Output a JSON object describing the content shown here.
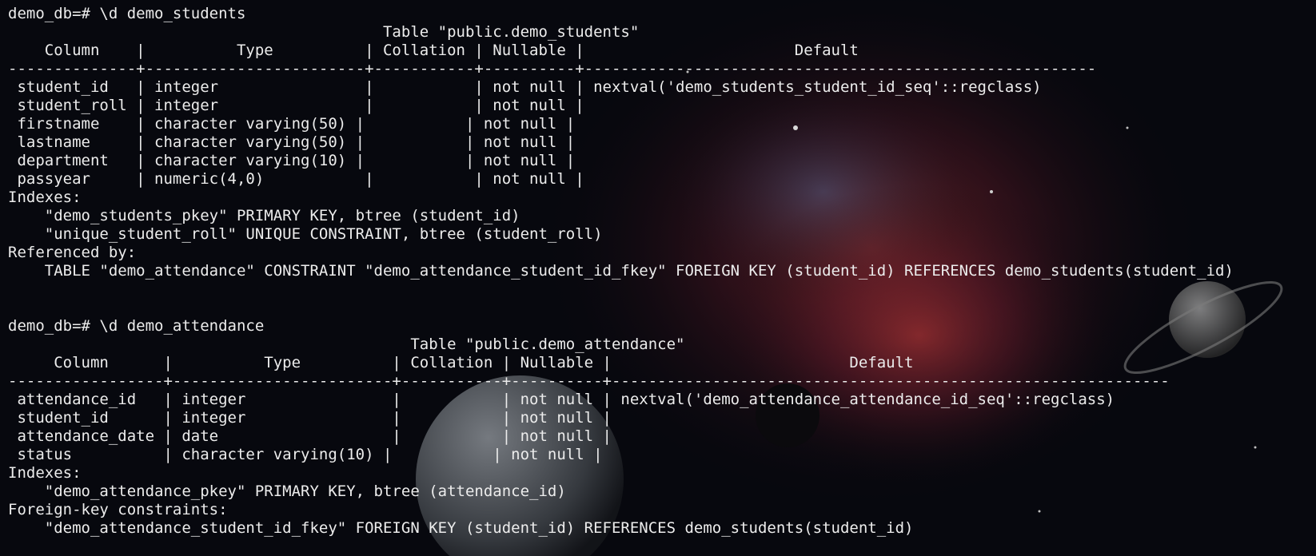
{
  "terminal": {
    "lines": [
      "demo_db=# \\d demo_students",
      "                                         Table \"public.demo_students\"",
      "    Column    |          Type          | Collation | Nullable |                       Default",
      "--------------+------------------------+-----------+----------+--------------------------------------------------------",
      " student_id   | integer                |           | not null | nextval('demo_students_student_id_seq'::regclass)",
      " student_roll | integer                |           | not null |",
      " firstname    | character varying(50) |           | not null |",
      " lastname     | character varying(50) |           | not null |",
      " department   | character varying(10) |           | not null |",
      " passyear     | numeric(4,0)           |           | not null |",
      "Indexes:",
      "    \"demo_students_pkey\" PRIMARY KEY, btree (student_id)",
      "    \"unique_student_roll\" UNIQUE CONSTRAINT, btree (student_roll)",
      "Referenced by:",
      "    TABLE \"demo_attendance\" CONSTRAINT \"demo_attendance_student_id_fkey\" FOREIGN KEY (student_id) REFERENCES demo_students(student_id)",
      "",
      "",
      "demo_db=# \\d demo_attendance",
      "                                            Table \"public.demo_attendance\"",
      "     Column      |          Type          | Collation | Nullable |                          Default",
      "-----------------+------------------------+-----------+----------+-------------------------------------------------------------",
      " attendance_id   | integer                |           | not null | nextval('demo_attendance_attendance_id_seq'::regclass)",
      " student_id      | integer                |           | not null |",
      " attendance_date | date                   |           | not null |",
      " status          | character varying(10) |           | not null |",
      "Indexes:",
      "    \"demo_attendance_pkey\" PRIMARY KEY, btree (attendance_id)",
      "Foreign-key constraints:",
      "    \"demo_attendance_student_id_fkey\" FOREIGN KEY (student_id) REFERENCES demo_students(student_id)"
    ]
  },
  "theme": {
    "background": "#07080e",
    "text": "#ececec"
  }
}
